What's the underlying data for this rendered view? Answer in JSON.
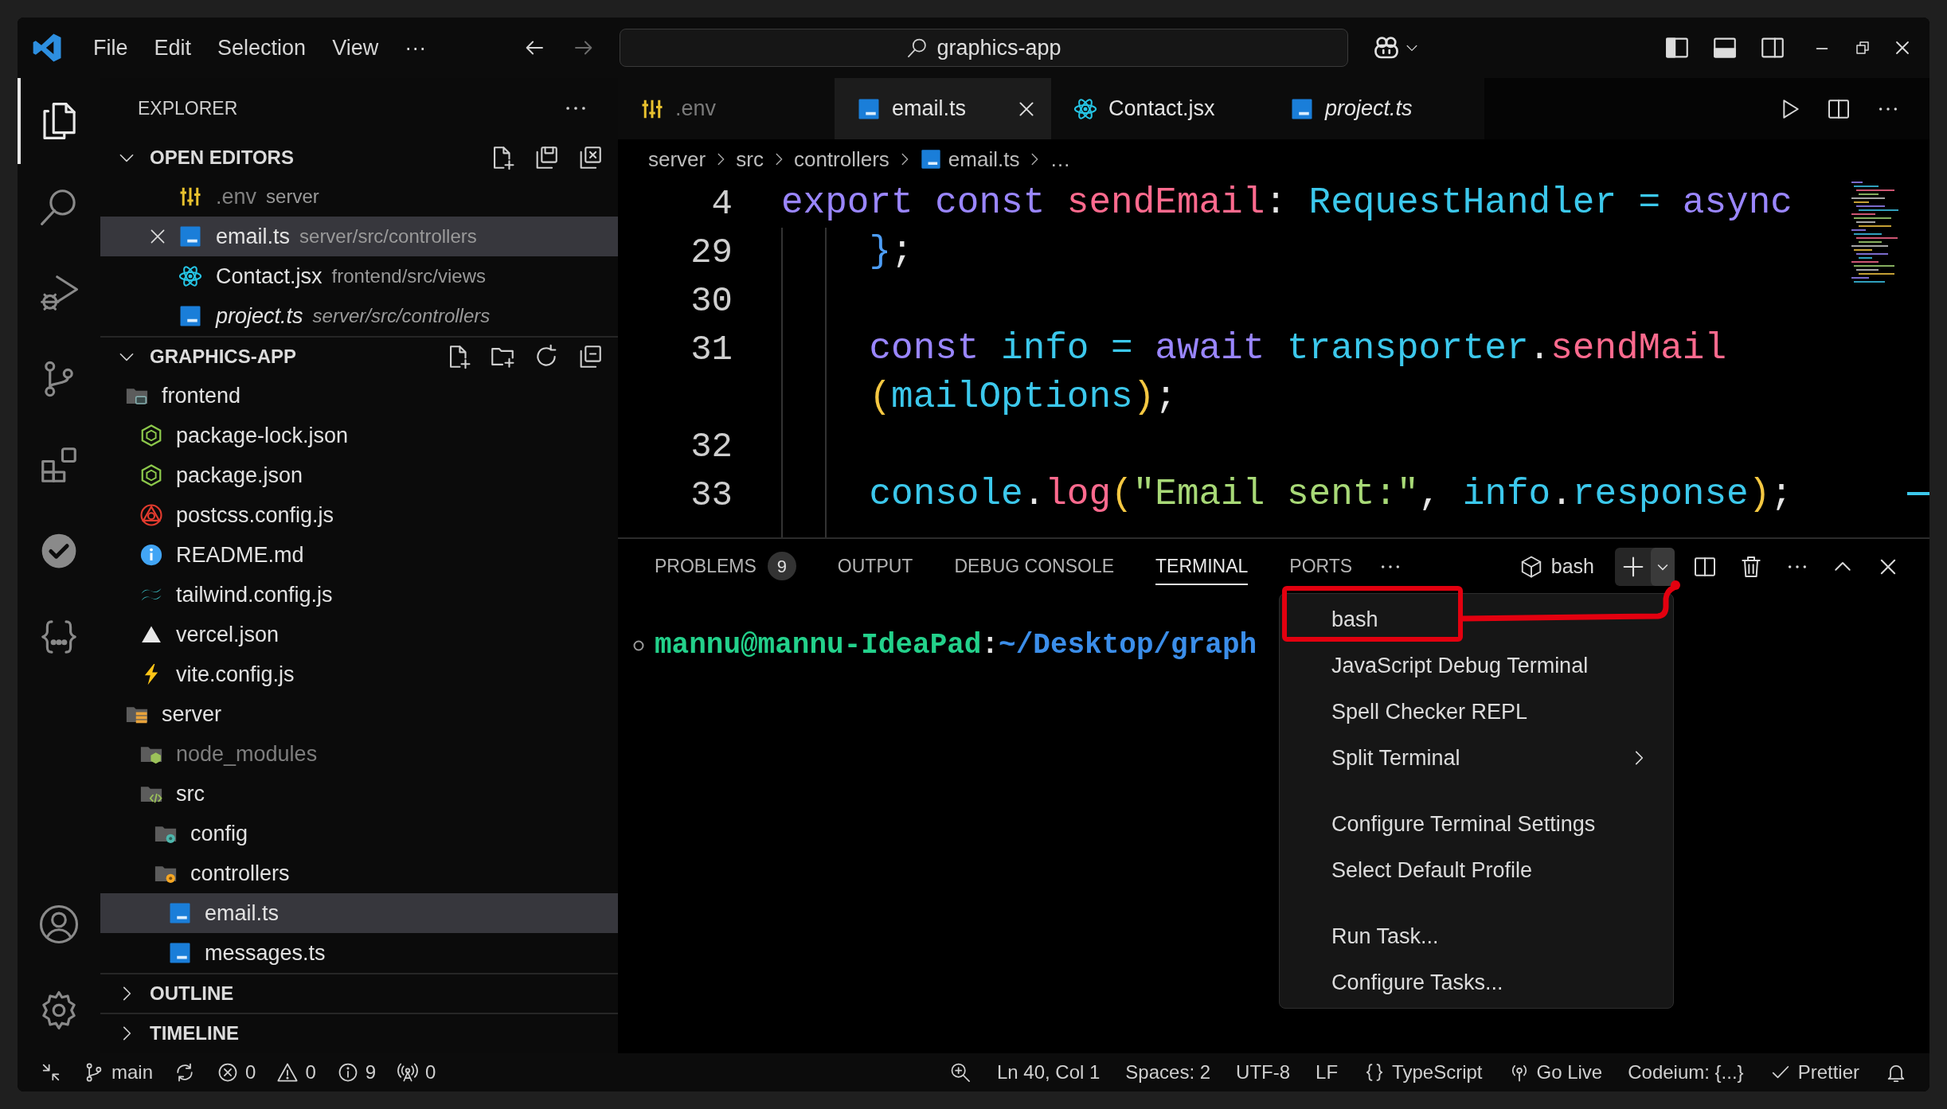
{
  "title_bar": {
    "menus": [
      "File",
      "Edit",
      "Selection",
      "View",
      "···"
    ],
    "command_center": "graphics-app"
  },
  "activity_bar": {
    "items": [
      {
        "kind": "explorer",
        "selected": true
      },
      {
        "kind": "search",
        "selected": false
      },
      {
        "kind": "run-debug",
        "selected": false
      },
      {
        "kind": "source-control",
        "selected": false
      },
      {
        "kind": "extensions",
        "selected": false
      },
      {
        "kind": "testing",
        "selected": false
      },
      {
        "kind": "json",
        "selected": false
      }
    ],
    "bottom": [
      {
        "kind": "account"
      },
      {
        "kind": "settings"
      }
    ]
  },
  "sidebar": {
    "title": "EXPLORER",
    "sections": [
      {
        "label": "OPEN EDITORS",
        "kind": "open-editors",
        "expanded": true,
        "items": [
          {
            "name": ".env",
            "path": "server",
            "kind": "env",
            "selected": false,
            "dimmed": true,
            "italic": false
          },
          {
            "name": "email.ts",
            "path": "server/src/controllers",
            "kind": "typescript",
            "selected": true,
            "dimmed": false,
            "italic": false
          },
          {
            "name": "Contact.jsx",
            "path": "frontend/src/views",
            "kind": "react",
            "selected": false,
            "dimmed": false,
            "italic": false
          },
          {
            "name": "project.ts",
            "path": "server/src/controllers",
            "kind": "typescript",
            "selected": false,
            "dimmed": false,
            "italic": true
          }
        ]
      },
      {
        "label": "GRAPHICS-APP",
        "kind": "folder",
        "expanded": true,
        "items": [
          {
            "name": "frontend",
            "kind": "folder-frontend",
            "selected": false,
            "dimmed": false,
            "children": [
              {
                "name": "package-lock.json",
                "kind": "node",
                "selected": false,
                "dimmed": false
              },
              {
                "name": "package.json",
                "kind": "node",
                "selected": false,
                "dimmed": false
              },
              {
                "name": "postcss.config.js",
                "kind": "postcss",
                "selected": false,
                "dimmed": false
              },
              {
                "name": "README.md",
                "kind": "info",
                "selected": false,
                "dimmed": false
              },
              {
                "name": "tailwind.config.js",
                "kind": "tailwind",
                "selected": false,
                "dimmed": false
              },
              {
                "name": "vercel.json",
                "kind": "vercel",
                "selected": false,
                "dimmed": false
              },
              {
                "name": "vite.config.js",
                "kind": "vite",
                "selected": false,
                "dimmed": false
              }
            ]
          },
          {
            "name": "server",
            "kind": "folder-server",
            "selected": false,
            "dimmed": false,
            "children": [
              {
                "name": "node_modules",
                "kind": "folder-node",
                "selected": false,
                "dimmed": true
              },
              {
                "name": "src",
                "kind": "folder-src",
                "selected": false,
                "dimmed": false,
                "children": [
                  {
                    "name": "config",
                    "kind": "folder-config",
                    "selected": false,
                    "dimmed": false
                  },
                  {
                    "name": "controllers",
                    "kind": "folder-controllers",
                    "selected": false,
                    "dimmed": false,
                    "children": [
                      {
                        "name": "email.ts",
                        "kind": "typescript",
                        "selected": true,
                        "dimmed": false
                      },
                      {
                        "name": "messages.ts",
                        "kind": "typescript",
                        "selected": false,
                        "dimmed": false
                      }
                    ]
                  }
                ]
              }
            ]
          }
        ]
      },
      {
        "label": "OUTLINE",
        "expanded": false
      },
      {
        "label": "TIMELINE",
        "expanded": false
      }
    ]
  },
  "editor": {
    "tabs": [
      {
        "label": ".env",
        "kind": "env",
        "selected": false,
        "dimmed": true,
        "italic": false
      },
      {
        "label": "email.ts",
        "kind": "typescript",
        "selected": true,
        "dimmed": false,
        "italic": false
      },
      {
        "label": "Contact.jsx",
        "kind": "react",
        "selected": false,
        "dimmed": false,
        "italic": false
      },
      {
        "label": "project.ts",
        "kind": "typescript",
        "selected": false,
        "dimmed": false,
        "italic": true
      }
    ],
    "breadcrumbs": [
      {
        "label": "server",
        "kind": "folder"
      },
      {
        "label": "src",
        "kind": "folder"
      },
      {
        "label": "controllers",
        "kind": "folder"
      },
      {
        "label": "email.ts",
        "kind": "typescript"
      },
      {
        "label": "…",
        "kind": "more"
      }
    ],
    "lines": [
      {
        "number": "4",
        "tokens": [
          {
            "text": "export const ",
            "color": "#9a86ff"
          },
          {
            "text": "sendEmail",
            "color": "#ff6a8e"
          },
          {
            "text": ": ",
            "color": "#e6e6e6"
          },
          {
            "text": "RequestHandler = ",
            "color": "#3cc8ec"
          },
          {
            "text": "async",
            "color": "#9a86ff"
          }
        ]
      },
      {
        "number": "29",
        "tokens": [
          {
            "text": "    }",
            "color": "#4d9df5"
          },
          {
            "text": ";",
            "color": "#e6e6e6"
          }
        ]
      },
      {
        "number": "30"
      },
      {
        "number": "31",
        "tokens": [
          {
            "text": "    const ",
            "color": "#9a86ff"
          },
          {
            "text": "info = ",
            "color": "#3cc8ec"
          },
          {
            "text": "await ",
            "color": "#9a86ff"
          },
          {
            "text": "transporter",
            "color": "#3cc8ec"
          },
          {
            "text": ".",
            "color": "#e6e6e6"
          },
          {
            "text": "sendMail",
            "color": "#ff6a8e"
          }
        ]
      },
      {
        "tokens": [
          {
            "text": "    (",
            "color": "#f5c842"
          },
          {
            "text": "mailOptions",
            "color": "#3cc8ec"
          },
          {
            "text": ")",
            "color": "#f5c842"
          },
          {
            "text": ";",
            "color": "#e6e6e6"
          }
        ]
      },
      {
        "number": "32"
      },
      {
        "number": "33",
        "tokens": [
          {
            "text": "    console",
            "color": "#3cc8ec"
          },
          {
            "text": ".",
            "color": "#e6e6e6"
          },
          {
            "text": "log",
            "color": "#ff6a8e"
          },
          {
            "text": "(",
            "color": "#f5c842"
          },
          {
            "text": "\"Email sent:\"",
            "color": "#a8d977"
          },
          {
            "text": ", ",
            "color": "#e6e6e6"
          },
          {
            "text": "info",
            "color": "#3cc8ec"
          },
          {
            "text": ".",
            "color": "#e6e6e6"
          },
          {
            "text": "response",
            "color": "#3cc8ec"
          },
          {
            "text": ")",
            "color": "#f5c842"
          },
          {
            "text": ";",
            "color": "#e6e6e6"
          }
        ]
      }
    ]
  },
  "panel": {
    "tabs": [
      {
        "label": "PROBLEMS",
        "selected": false,
        "badge": "9"
      },
      {
        "label": "OUTPUT",
        "selected": false
      },
      {
        "label": "DEBUG CONSOLE",
        "selected": false
      },
      {
        "label": "TERMINAL",
        "selected": true
      },
      {
        "label": "PORTS",
        "selected": false
      }
    ],
    "terminal_name": "bash",
    "prompt": {
      "user": "mannu@mannu-IdeaPad",
      "separator": ":",
      "path": "~/Desktop/graph"
    }
  },
  "terminal_menu": {
    "groups": [
      [
        {
          "label": "bash",
          "submenu": false
        },
        {
          "label": "JavaScript Debug Terminal",
          "submenu": false
        },
        {
          "label": "Spell Checker REPL",
          "submenu": false
        },
        {
          "label": "Split Terminal",
          "submenu": true
        }
      ],
      [
        {
          "label": "Configure Terminal Settings",
          "submenu": false
        },
        {
          "label": "Select Default Profile",
          "submenu": false
        }
      ],
      [
        {
          "label": "Run Task...",
          "submenu": false
        },
        {
          "label": "Configure Tasks...",
          "submenu": false
        }
      ]
    ]
  },
  "status_bar": {
    "left": [
      {
        "kind": "remote"
      },
      {
        "kind": "branch",
        "text": "main"
      },
      {
        "kind": "sync"
      },
      {
        "kind": "errors",
        "text": "0"
      },
      {
        "kind": "warnings",
        "text": "0"
      },
      {
        "kind": "infos",
        "text": "9"
      },
      {
        "kind": "ports",
        "text": "0"
      }
    ],
    "right": [
      {
        "kind": "zoom"
      },
      {
        "kind": "text",
        "text": "Ln 40, Col 1"
      },
      {
        "kind": "text",
        "text": "Spaces: 2"
      },
      {
        "kind": "text",
        "text": "UTF-8"
      },
      {
        "kind": "text",
        "text": "LF"
      },
      {
        "kind": "language",
        "text": "TypeScript"
      },
      {
        "kind": "golive",
        "text": "Go Live"
      },
      {
        "kind": "text",
        "text": "Codeium: {...}"
      },
      {
        "kind": "prettier",
        "text": "Prettier"
      },
      {
        "kind": "bell"
      }
    ]
  }
}
